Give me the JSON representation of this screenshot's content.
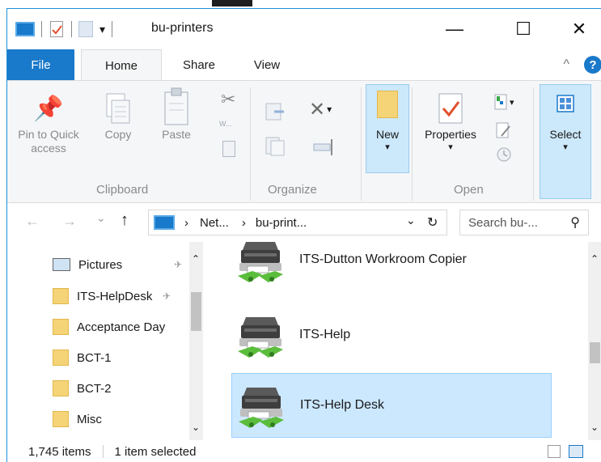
{
  "window": {
    "title": "bu-printers",
    "minimize_glyph": "—",
    "maximize_glyph": "☐",
    "close_glyph": "✕",
    "qa_dropdown_glyph": "▾"
  },
  "tabs": {
    "file": "File",
    "home": "Home",
    "share": "Share",
    "view": "View",
    "collapse_glyph": "^",
    "help_glyph": "?"
  },
  "ribbon": {
    "pin_to_quick_access": "Pin to Quick access",
    "copy": "Copy",
    "paste": "Paste",
    "new": "New",
    "properties": "Properties",
    "select": "Select",
    "groups": {
      "clipboard": "Clipboard",
      "organize": "Organize",
      "open": "Open"
    },
    "dropdown_glyph": "▾",
    "copy_path_icon_text": "W...",
    "delete_glyph": "✕"
  },
  "navigation": {
    "back": "←",
    "forward": "→",
    "recent": "⌄",
    "up": "↑",
    "breadcrumb_sep": "›",
    "crumbs": [
      "Net...",
      "bu-print..."
    ],
    "dropdown": "⌄",
    "refresh": "↻",
    "search_placeholder": "Search bu-...",
    "search_glyph": "⚲"
  },
  "nav_pane": {
    "items": [
      {
        "label": "Pictures",
        "icon": "pictures-icon",
        "pinned": true
      },
      {
        "label": "ITS-HelpDesk",
        "icon": "folder-icon",
        "pinned": true
      },
      {
        "label": "Acceptance Day",
        "icon": "folder-icon",
        "pinned": false
      },
      {
        "label": "BCT-1",
        "icon": "folder-icon",
        "pinned": false
      },
      {
        "label": "BCT-2",
        "icon": "folder-icon",
        "pinned": false
      },
      {
        "label": "Misc",
        "icon": "folder-icon",
        "pinned": false
      }
    ],
    "pin_glyph": "✈"
  },
  "files": [
    {
      "name": "ITS-Dutton Workroom Copier",
      "selected": false
    },
    {
      "name": "ITS-Help",
      "selected": false
    },
    {
      "name": "ITS-Help Desk",
      "selected": true
    }
  ],
  "status": {
    "item_count": "1,745 items",
    "selection": "1 item selected"
  },
  "colors": {
    "accent": "#1979ca",
    "selection": "#cce8ff",
    "folder": "#f5d478"
  }
}
